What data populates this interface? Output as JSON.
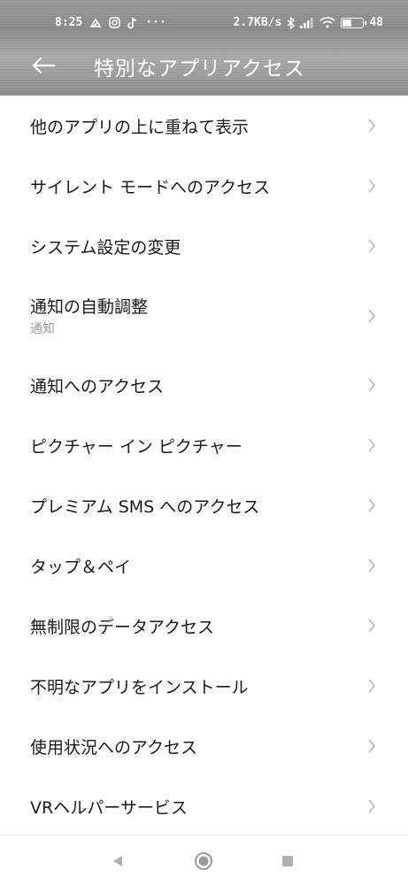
{
  "status_bar": {
    "time": "8:25",
    "left_icons": [
      "notification-icon",
      "instagram-icon",
      "tiktok-icon",
      "more-icon"
    ],
    "more": "···",
    "net_speed": "2.7KB/s",
    "battery": "48",
    "battery_level": 0.48,
    "icons": [
      "bluetooth-icon",
      "signal-icon",
      "wifi-icon",
      "battery-icon"
    ]
  },
  "header": {
    "title": "特別なアプリアクセス",
    "background_color": "#8f8f8f"
  },
  "items": [
    {
      "label": "他のアプリの上に重ねて表示"
    },
    {
      "label": "サイレント モードへのアクセス"
    },
    {
      "label": "システム設定の変更"
    },
    {
      "label": "通知の自動調整",
      "subtitle": "通知"
    },
    {
      "label": "通知へのアクセス"
    },
    {
      "label": "ピクチャー イン ピクチャー"
    },
    {
      "label": "プレミアム SMS へのアクセス"
    },
    {
      "label": "タップ＆ペイ"
    },
    {
      "label": "無制限のデータアクセス"
    },
    {
      "label": "不明なアプリをインストール"
    },
    {
      "label": "使用状況へのアクセス"
    },
    {
      "label": "VRヘルパーサービス"
    }
  ],
  "nav": {
    "buttons": [
      "back-icon",
      "home-icon",
      "recents-icon"
    ]
  },
  "colors": {
    "text": "#1a1a1a",
    "subtitle": "#9a9a9a",
    "chevron": "#b5b5b5",
    "nav_icon": "#9a9a9a"
  }
}
